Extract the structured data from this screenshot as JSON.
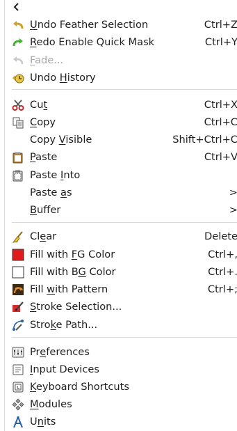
{
  "back_icon": "chevron-left-icon",
  "groups": [
    [
      {
        "name": "undo",
        "pre": "",
        "key": "U",
        "post": "ndo Feather Selection",
        "shortcut": "Ctrl+Z",
        "icon": "undo-icon",
        "disabled": false
      },
      {
        "name": "redo",
        "pre": "",
        "key": "R",
        "post": "edo Enable Quick Mask",
        "shortcut": "Ctrl+Y",
        "icon": "redo-icon",
        "disabled": false
      },
      {
        "name": "fade",
        "pre": "",
        "key": "F",
        "post": "ade...",
        "shortcut": "",
        "icon": "fade-icon",
        "disabled": true
      },
      {
        "name": "undo-history",
        "pre": "Undo ",
        "key": "H",
        "post": "istory",
        "shortcut": "",
        "icon": "undo-history-icon",
        "disabled": false
      }
    ],
    [
      {
        "name": "cut",
        "pre": "Cu",
        "key": "t",
        "post": "",
        "shortcut": "Ctrl+X",
        "icon": "scissors-icon",
        "disabled": false
      },
      {
        "name": "copy",
        "pre": "",
        "key": "C",
        "post": "opy",
        "shortcut": "Ctrl+C",
        "icon": "copy-icon",
        "disabled": false
      },
      {
        "name": "copy-visible",
        "pre": "Copy ",
        "key": "V",
        "post": "isible",
        "shortcut": "Shift+Ctrl+C",
        "icon": "",
        "disabled": false
      },
      {
        "name": "paste",
        "pre": "",
        "key": "P",
        "post": "aste",
        "shortcut": "Ctrl+V",
        "icon": "paste-icon",
        "disabled": false
      },
      {
        "name": "paste-into",
        "pre": "Paste ",
        "key": "I",
        "post": "nto",
        "shortcut": "",
        "icon": "paste-into-icon",
        "disabled": false
      },
      {
        "name": "paste-as",
        "pre": "Paste ",
        "key": "a",
        "post": "s",
        "shortcut": "",
        "icon": "",
        "disabled": false,
        "submenu": true
      },
      {
        "name": "buffer",
        "pre": "",
        "key": "B",
        "post": "uffer",
        "shortcut": "",
        "icon": "",
        "disabled": false,
        "submenu": true
      }
    ],
    [
      {
        "name": "clear",
        "pre": "Cl",
        "key": "e",
        "post": "ar",
        "shortcut": "Delete",
        "icon": "broom-icon",
        "disabled": false
      },
      {
        "name": "fill-fg",
        "pre": "Fill with ",
        "key": "F",
        "post": "G Color",
        "shortcut": "Ctrl+,",
        "icon": "fg-color-swatch-icon",
        "disabled": false
      },
      {
        "name": "fill-bg",
        "pre": "Fill with B",
        "key": "G",
        "post": " Color",
        "shortcut": "Ctrl+.",
        "icon": "bg-color-swatch-icon",
        "disabled": false
      },
      {
        "name": "fill-pattern",
        "pre": "Fill ",
        "key": "w",
        "post": "ith Pattern",
        "shortcut": "Ctrl+;",
        "icon": "pattern-icon",
        "disabled": false
      },
      {
        "name": "stroke-selection",
        "pre": "",
        "key": "S",
        "post": "troke Selection...",
        "shortcut": "",
        "icon": "stroke-selection-icon",
        "disabled": false
      },
      {
        "name": "stroke-path",
        "pre": "Stro",
        "key": "k",
        "post": "e Path...",
        "shortcut": "",
        "icon": "stroke-path-icon",
        "disabled": false
      }
    ],
    [
      {
        "name": "preferences",
        "pre": "Pr",
        "key": "e",
        "post": "ferences",
        "shortcut": "",
        "icon": "preferences-icon",
        "disabled": false
      },
      {
        "name": "input-devices",
        "pre": "",
        "key": "I",
        "post": "nput Devices",
        "shortcut": "",
        "icon": "input-devices-icon",
        "disabled": false
      },
      {
        "name": "keyboard-shortcuts",
        "pre": "",
        "key": "K",
        "post": "eyboard Shortcuts",
        "shortcut": "",
        "icon": "keyboard-icon",
        "disabled": false
      },
      {
        "name": "modules",
        "pre": "",
        "key": "M",
        "post": "odules",
        "shortcut": "",
        "icon": "modules-icon",
        "disabled": false
      },
      {
        "name": "units",
        "pre": "U",
        "key": "n",
        "post": "its",
        "shortcut": "",
        "icon": "units-icon",
        "disabled": false
      }
    ]
  ],
  "submenu_arrow": ">",
  "colors": {
    "fg_fill": "#e01b1b",
    "bg_fill": "#ffffff",
    "text": "#1f1f1f",
    "disabled": "#a9a9a9",
    "separator": "#d8d8d8"
  }
}
